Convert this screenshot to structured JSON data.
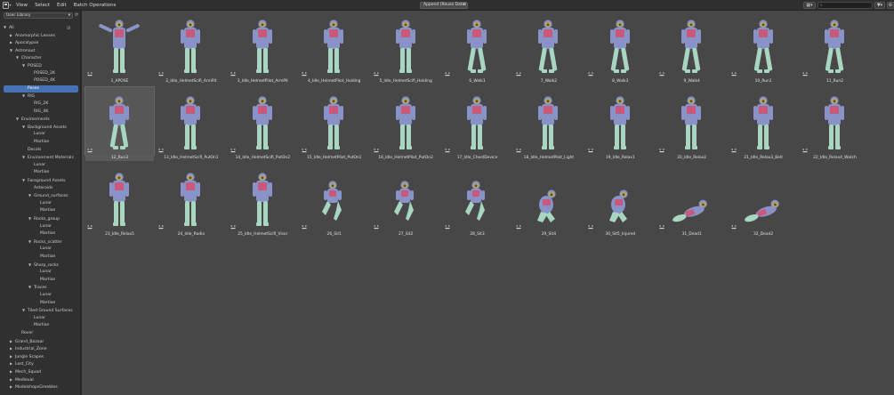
{
  "header": {
    "menus": [
      "View",
      "Select",
      "Edit",
      "Batch Operations"
    ],
    "import_method": "Append (Reuse Data)"
  },
  "sidebar": {
    "library": "User Library",
    "tree": [
      {
        "label": "All",
        "depth": 0,
        "arrow": "down"
      },
      {
        "label": "Anamorphic Lenses",
        "depth": 1,
        "arrow": "right"
      },
      {
        "label": "Apocalypse",
        "depth": 1,
        "arrow": "right"
      },
      {
        "label": "Astronaut",
        "depth": 1,
        "arrow": "down"
      },
      {
        "label": "Character",
        "depth": 2,
        "arrow": "down"
      },
      {
        "label": "POSED",
        "depth": 3,
        "arrow": "down"
      },
      {
        "label": "POSED_2K",
        "depth": 4,
        "arrow": ""
      },
      {
        "label": "POSED_4K",
        "depth": 4,
        "arrow": ""
      },
      {
        "label": "Poses",
        "depth": 3,
        "arrow": "",
        "selected": true
      },
      {
        "label": "RIG",
        "depth": 3,
        "arrow": "down"
      },
      {
        "label": "RIG_2K",
        "depth": 4,
        "arrow": ""
      },
      {
        "label": "RIG_4K",
        "depth": 4,
        "arrow": ""
      },
      {
        "label": "Environments",
        "depth": 2,
        "arrow": "down"
      },
      {
        "label": "Background Assets",
        "depth": 3,
        "arrow": "down"
      },
      {
        "label": "Lunar",
        "depth": 4,
        "arrow": ""
      },
      {
        "label": "Martian",
        "depth": 4,
        "arrow": ""
      },
      {
        "label": "Decals",
        "depth": 3,
        "arrow": ""
      },
      {
        "label": "Environment Materials",
        "depth": 3,
        "arrow": "down"
      },
      {
        "label": "Lunar",
        "depth": 4,
        "arrow": ""
      },
      {
        "label": "Martian",
        "depth": 4,
        "arrow": ""
      },
      {
        "label": "Foreground Assets",
        "depth": 3,
        "arrow": "down"
      },
      {
        "label": "Asteroids",
        "depth": 4,
        "arrow": ""
      },
      {
        "label": "Ground_surfaces",
        "depth": 4,
        "arrow": "down"
      },
      {
        "label": "Lunar",
        "depth": 5,
        "arrow": ""
      },
      {
        "label": "Martian",
        "depth": 5,
        "arrow": ""
      },
      {
        "label": "Rocks_group",
        "depth": 4,
        "arrow": "down"
      },
      {
        "label": "Lunar",
        "depth": 5,
        "arrow": ""
      },
      {
        "label": "Martian",
        "depth": 5,
        "arrow": ""
      },
      {
        "label": "Rocks_scatter",
        "depth": 4,
        "arrow": "down"
      },
      {
        "label": "Lunar",
        "depth": 5,
        "arrow": ""
      },
      {
        "label": "Martian",
        "depth": 5,
        "arrow": ""
      },
      {
        "label": "Sharp_rocks",
        "depth": 4,
        "arrow": "down"
      },
      {
        "label": "Lunar",
        "depth": 5,
        "arrow": ""
      },
      {
        "label": "Martian",
        "depth": 5,
        "arrow": ""
      },
      {
        "label": "Traces",
        "depth": 4,
        "arrow": "down"
      },
      {
        "label": "Lunar",
        "depth": 5,
        "arrow": ""
      },
      {
        "label": "Martian",
        "depth": 5,
        "arrow": ""
      },
      {
        "label": "Tiled Ground Surfaces",
        "depth": 3,
        "arrow": "down"
      },
      {
        "label": "Lunar",
        "depth": 4,
        "arrow": ""
      },
      {
        "label": "Martian",
        "depth": 4,
        "arrow": ""
      },
      {
        "label": "Rover",
        "depth": 2,
        "arrow": ""
      },
      {
        "label": "Grand_Bazaar",
        "depth": 1,
        "arrow": "right"
      },
      {
        "label": "Industrial_Zone",
        "depth": 1,
        "arrow": "right"
      },
      {
        "label": "Jungle Scapes",
        "depth": 1,
        "arrow": "right"
      },
      {
        "label": "Lost_City",
        "depth": 1,
        "arrow": "right"
      },
      {
        "label": "Mech_Squad",
        "depth": 1,
        "arrow": "right"
      },
      {
        "label": "Medieval",
        "depth": 1,
        "arrow": "right"
      },
      {
        "label": "ModelshopsGreebles",
        "depth": 1,
        "arrow": "right"
      }
    ]
  },
  "assets": [
    {
      "name": "1_APOSE",
      "pose": "apose"
    },
    {
      "name": "2_Idle_HelmetScifi_ArmPit",
      "pose": "stand"
    },
    {
      "name": "3_Idle_HelmetPilot_ArmPit",
      "pose": "stand"
    },
    {
      "name": "4_Idle_HelmetPilot_Holding",
      "pose": "stand"
    },
    {
      "name": "5_Idle_HelmetScifi_Holding",
      "pose": "stand"
    },
    {
      "name": "6_Walk1",
      "pose": "walk"
    },
    {
      "name": "7_Walk2",
      "pose": "walk"
    },
    {
      "name": "8_Walk3",
      "pose": "walk"
    },
    {
      "name": "9_Walk4",
      "pose": "walk"
    },
    {
      "name": "10_Run1",
      "pose": "walk"
    },
    {
      "name": "11_Run2",
      "pose": "walk"
    },
    {
      "name": "12_Run3",
      "pose": "walk",
      "selected": true
    },
    {
      "name": "13_Idle_HelmetScifi_PutOn1",
      "pose": "stand"
    },
    {
      "name": "14_Idle_HelmetScifi_PutOn2",
      "pose": "stand"
    },
    {
      "name": "15_Idle_HelmetPilot_PutOn1",
      "pose": "stand"
    },
    {
      "name": "16_Idle_HelmetPilot_PutOn2",
      "pose": "stand"
    },
    {
      "name": "17_Idle_ChestDevice",
      "pose": "stand"
    },
    {
      "name": "18_Idle_HelmetPilot_Light",
      "pose": "stand"
    },
    {
      "name": "19_Idle_Relax1",
      "pose": "stand"
    },
    {
      "name": "20_Idle_Relax2",
      "pose": "stand"
    },
    {
      "name": "21_Idle_Relax3_Belt",
      "pose": "stand"
    },
    {
      "name": "22_Idle_Relax4_Watch",
      "pose": "stand"
    },
    {
      "name": "23_Idle_Relax5",
      "pose": "stand"
    },
    {
      "name": "24_Idle_Radio",
      "pose": "stand"
    },
    {
      "name": "25_Idle_HelmetScifi_Visor",
      "pose": "stand"
    },
    {
      "name": "26_Sit1",
      "pose": "sit"
    },
    {
      "name": "27_Sit2",
      "pose": "sit"
    },
    {
      "name": "28_Sit3",
      "pose": "sit"
    },
    {
      "name": "29_Sit4",
      "pose": "crouch"
    },
    {
      "name": "30_Sit5_Injured",
      "pose": "crouch"
    },
    {
      "name": "31_Dead1",
      "pose": "dead"
    },
    {
      "name": "32_Dead2",
      "pose": "dead"
    }
  ],
  "colors": {
    "accent": "#4772b3",
    "suit_body": "#8a93c8",
    "suit_legs": "#a9d6c1",
    "suit_chest": "#c75a7a",
    "helmet": "#c6ae3c"
  }
}
